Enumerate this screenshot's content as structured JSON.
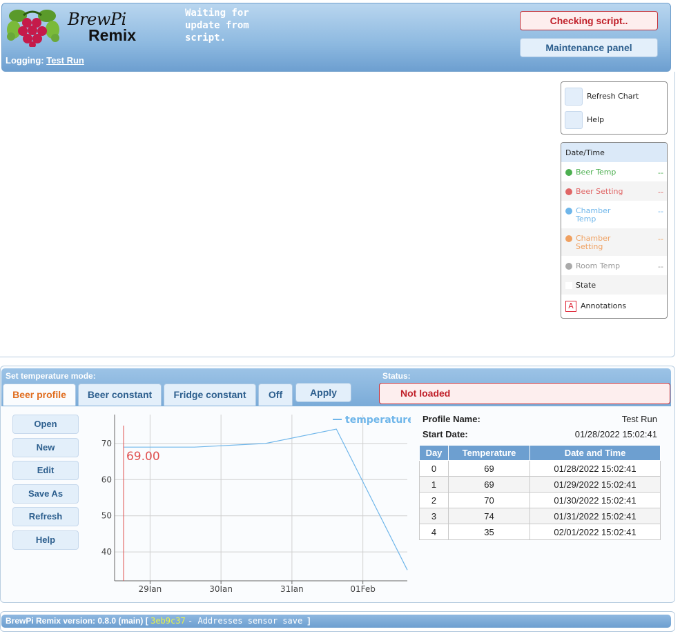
{
  "header": {
    "logo_line1": "BrewPi",
    "logo_line2": "Remix",
    "script_status": "Waiting for\nupdate from\nscript.",
    "logging_label": "Logging:",
    "logging_value": "Test Run",
    "checking_button": "Checking script..",
    "maintenance_button": "Maintenance panel"
  },
  "chart_controls": {
    "refresh": "Refresh Chart",
    "help": "Help"
  },
  "legend": {
    "header": "Date/Time",
    "items": [
      {
        "name": "Beer Temp",
        "value": "--",
        "color": "#4caf50"
      },
      {
        "name": "Beer Setting",
        "value": "--",
        "color": "#e06666"
      },
      {
        "name": "Chamber Temp",
        "value": "--",
        "color": "#6fb6ea"
      },
      {
        "name": "Chamber Setting",
        "value": "--",
        "color": "#f0a060"
      },
      {
        "name": "Room Temp",
        "value": "--",
        "color": "#aaaaaa"
      }
    ],
    "state": "State",
    "annotations_icon": "A",
    "annotations": "Annotations"
  },
  "control": {
    "mode_label": "Set temperature mode:",
    "status_label": "Status:",
    "tabs": [
      "Beer profile",
      "Beer constant",
      "Fridge constant",
      "Off"
    ],
    "apply": "Apply",
    "status_value": "Not loaded"
  },
  "profile_buttons": [
    "Open",
    "New",
    "Edit",
    "Save As",
    "Refresh",
    "Help"
  ],
  "profile": {
    "name_label": "Profile Name:",
    "name_value": "Test Run",
    "start_label": "Start Date:",
    "start_value": "01/28/2022 15:02:41",
    "table_headers": [
      "Day",
      "Temperature",
      "Date and Time"
    ],
    "rows": [
      [
        "0",
        "69",
        "01/28/2022 15:02:41"
      ],
      [
        "1",
        "69",
        "01/29/2022 15:02:41"
      ],
      [
        "2",
        "70",
        "01/30/2022 15:02:41"
      ],
      [
        "3",
        "74",
        "01/31/2022 15:02:41"
      ],
      [
        "4",
        "35",
        "02/01/2022 15:02:41"
      ]
    ]
  },
  "chart_data": {
    "type": "line",
    "series": [
      {
        "name": "temperature",
        "color": "#6fb6ea",
        "x": [
          "2022-01-28 15:02",
          "2022-01-29 15:02",
          "2022-01-30 15:02",
          "2022-01-31 15:02",
          "2022-02-01 15:02"
        ],
        "values": [
          69,
          69,
          70,
          74,
          35
        ]
      }
    ],
    "x_ticks": [
      "29Jan",
      "30Jan",
      "31Jan",
      "01Feb"
    ],
    "y_ticks": [
      40,
      50,
      60,
      70
    ],
    "ylim": [
      32,
      78
    ],
    "xlim": [
      "2022-01-28 12:00",
      "2022-02-01 15:02"
    ],
    "grid": true,
    "legend_position": "top-right",
    "marker_value": "69.00"
  },
  "footer": {
    "version": "BrewPi Remix version: 0.8.0 (main) [",
    "hash": "3eb9c37",
    "message": " - Addresses sensor save ",
    "close": "]"
  }
}
